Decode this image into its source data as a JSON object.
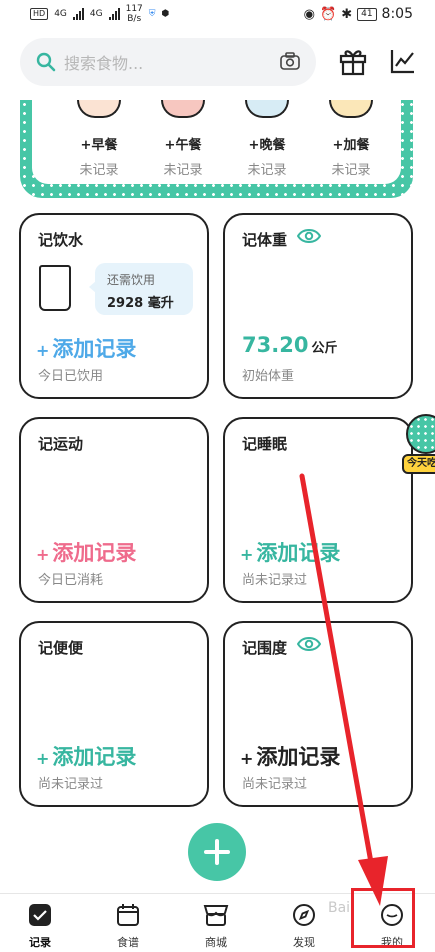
{
  "status_bar": {
    "net1": "4G",
    "net2": "4G",
    "speed_value": "117",
    "speed_unit": "B/s",
    "battery": "41",
    "time": "8:05"
  },
  "search": {
    "placeholder": "搜索食物..."
  },
  "meals": [
    {
      "name": "+早餐",
      "status": "未记录",
      "color": "#fbe3d3"
    },
    {
      "name": "+午餐",
      "status": "未记录",
      "color": "#f7c7c0"
    },
    {
      "name": "+晚餐",
      "status": "未记录",
      "color": "#d7ecf5"
    },
    {
      "name": "+加餐",
      "status": "未记录",
      "color": "#fbe7b8"
    }
  ],
  "cards": {
    "water": {
      "title": "记饮水",
      "need_label": "还需饮用",
      "need_value": "2928 毫升",
      "add": "添加记录",
      "hint": "今日已饮用"
    },
    "weight": {
      "title": "记体重",
      "value": "73.20",
      "unit": "公斤",
      "hint": "初始体重"
    },
    "exercise": {
      "title": "记运动",
      "add": "添加记录",
      "hint": "今日已消耗"
    },
    "sleep": {
      "title": "记睡眠",
      "add": "添加记录",
      "hint": "尚未记录过"
    },
    "poop": {
      "title": "记便便",
      "add": "添加记录",
      "hint": "尚未记录过"
    },
    "measure": {
      "title": "记围度",
      "add": "添加记录",
      "hint": "尚未记录过"
    }
  },
  "today_badge": "今天吃",
  "tabs": [
    {
      "label": "记录",
      "icon": "check-square-icon"
    },
    {
      "label": "食谱",
      "icon": "calendar-icon"
    },
    {
      "label": "商城",
      "icon": "store-icon"
    },
    {
      "label": "发现",
      "icon": "compass-icon"
    },
    {
      "label": "我的",
      "icon": "profile-icon"
    }
  ],
  "watermark": "Bai",
  "colors": {
    "accent": "#47c6a6",
    "teal_text": "#37b6a0",
    "blue_text": "#4ea9e8",
    "pink_text": "#ef6b8c",
    "annotation": "#e8242b"
  }
}
